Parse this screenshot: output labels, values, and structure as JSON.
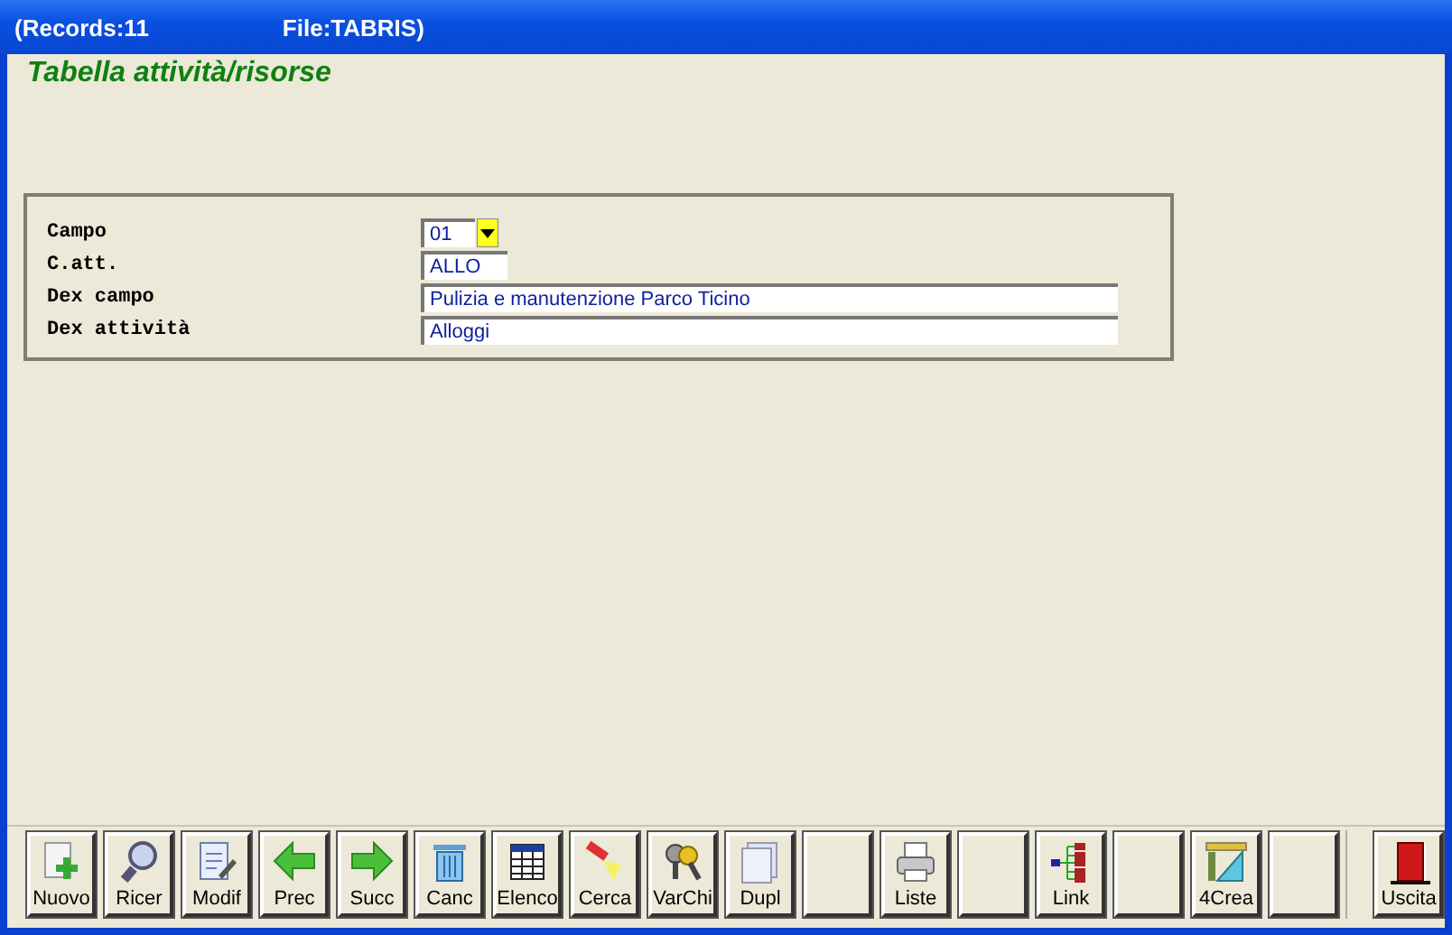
{
  "window": {
    "records": "(Records:11",
    "file": "File:TABRIS)"
  },
  "heading": "Tabella attività/risorse",
  "fields": [
    {
      "label": "Campo",
      "kind": "combo",
      "value": "01"
    },
    {
      "label": "C.att.",
      "kind": "short",
      "value": "ALLO"
    },
    {
      "label": "Dex campo",
      "kind": "long",
      "value": "Pulizia e manutenzione Parco Ticino"
    },
    {
      "label": "Dex attività",
      "kind": "long",
      "value": "Alloggi"
    }
  ],
  "toolbar": [
    {
      "kind": "command",
      "label": "Nuovo"
    },
    {
      "kind": "command",
      "label": "Ricer"
    },
    {
      "kind": "command",
      "label": "Modif"
    },
    {
      "kind": "command",
      "label": "Prec"
    },
    {
      "kind": "command",
      "label": "Succ"
    },
    {
      "kind": "command",
      "label": "Canc"
    },
    {
      "kind": "command",
      "label": "Elenco"
    },
    {
      "kind": "command",
      "label": "Cerca"
    },
    {
      "kind": "command",
      "label": "VarChi"
    },
    {
      "kind": "command",
      "label": "Dupl"
    },
    {
      "kind": "blank"
    },
    {
      "kind": "command",
      "label": "Liste"
    },
    {
      "kind": "blank"
    },
    {
      "kind": "command",
      "label": "Link"
    },
    {
      "kind": "blank"
    },
    {
      "kind": "command",
      "label": "4Crea"
    },
    {
      "kind": "blank"
    },
    {
      "kind": "exit",
      "label": "Uscita"
    }
  ]
}
